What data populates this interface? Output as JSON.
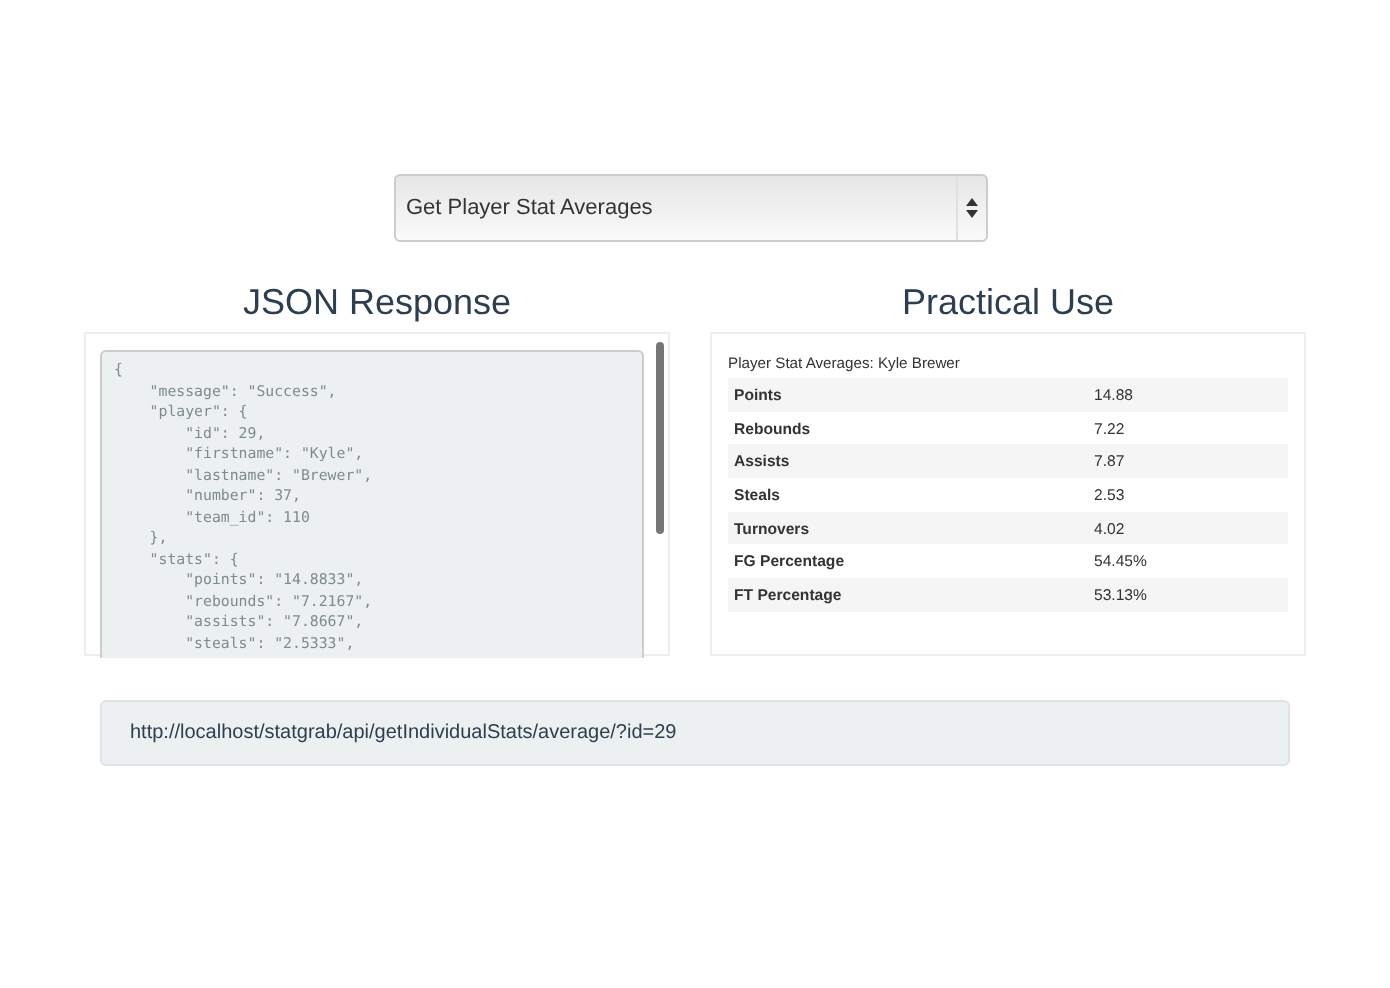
{
  "endpoint_select": {
    "value": "Get Player Stat Averages"
  },
  "json_panel": {
    "title": "JSON Response",
    "code_lines": [
      "{",
      "    \"message\": \"Success\",",
      "    \"player\": {",
      "        \"id\": 29,",
      "        \"firstname\": \"Kyle\",",
      "        \"lastname\": \"Brewer\",",
      "        \"number\": 37,",
      "        \"team_id\": 110",
      "    },",
      "    \"stats\": {",
      "        \"points\": \"14.8833\",",
      "        \"rebounds\": \"7.2167\",",
      "        \"assists\": \"7.8667\",",
      "        \"steals\": \"2.5333\","
    ]
  },
  "practical_panel": {
    "title": "Practical Use",
    "caption": "Player Stat Averages: Kyle Brewer",
    "rows": [
      {
        "label": "Points",
        "value": "14.88"
      },
      {
        "label": "Rebounds",
        "value": "7.22"
      },
      {
        "label": "Assists",
        "value": "7.87"
      },
      {
        "label": "Steals",
        "value": "2.53"
      },
      {
        "label": "Turnovers",
        "value": "4.02"
      },
      {
        "label": "FG Percentage",
        "value": "54.45%"
      },
      {
        "label": "FT Percentage",
        "value": "53.13%"
      }
    ]
  },
  "url_bar": {
    "text": "http://localhost/statgrab/api/getIndividualStats/average/?id=29"
  }
}
